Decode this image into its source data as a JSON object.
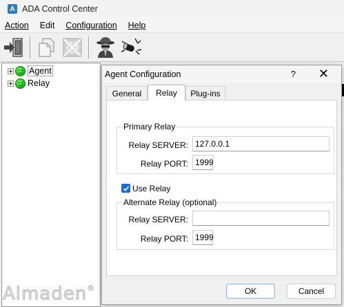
{
  "window": {
    "title": "ADA Control Center",
    "icon": "ada-app-icon"
  },
  "menu": [
    {
      "label": "Action"
    },
    {
      "label": "Edit"
    },
    {
      "label": "Configuration"
    },
    {
      "label": "Help"
    }
  ],
  "toolbar": {
    "buttons": [
      "exit-icon",
      "copy-icon",
      "settings-icon",
      "spy-agent-icon",
      "relay-connect-icon"
    ]
  },
  "tree": {
    "items": [
      {
        "label": "Agent",
        "status": "online"
      },
      {
        "label": "Relay",
        "status": "online"
      }
    ]
  },
  "watermark": {
    "text": "Almaden",
    "mark": "®"
  },
  "dialog": {
    "title": "Agent Configuration",
    "help": "?",
    "close": "✕",
    "tabs": [
      "General",
      "Relay",
      "Plug-ins"
    ],
    "active_tab": "Relay",
    "primary": {
      "legend": "Primary Relay",
      "server_label": "Relay SERVER:",
      "server_value": "127.0.0.1",
      "port_label": "Relay PORT:",
      "port_value": "1999"
    },
    "use_relay": {
      "label": "Use Relay",
      "checked": true
    },
    "alternate": {
      "legend": "Alternate Relay (optional)",
      "server_label": "Relay SERVER:",
      "server_value": "",
      "port_label": "Relay PORT:",
      "port_value": "1999"
    },
    "ok": "OK",
    "cancel": "Cancel"
  },
  "colors": {
    "accent": "#1d6ccf",
    "status_online": "#18b818"
  }
}
